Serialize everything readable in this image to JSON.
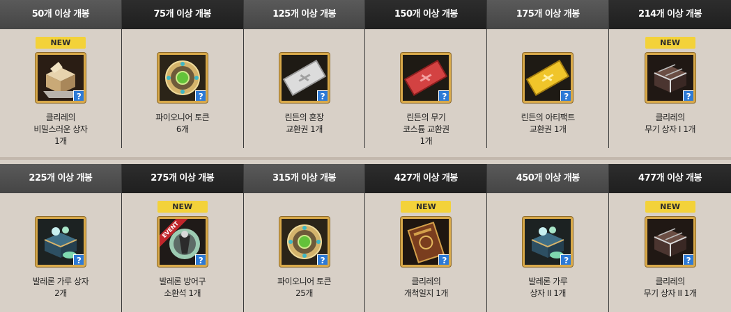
{
  "rows": [
    {
      "cells": [
        {
          "header": "50개 이상 개봉",
          "badge": "NEW",
          "icon": "box-icon",
          "lines": [
            "클리레의",
            "비밀스러운 상자",
            "1개"
          ]
        },
        {
          "header": "75개 이상 개봉",
          "badge": "",
          "icon": "pioneer-token-icon",
          "lines": [
            "파이오니어 토큰",
            "6개"
          ]
        },
        {
          "header": "125개 이상 개봉",
          "badge": "",
          "icon": "silver-ticket-icon",
          "lines": [
            "린든의 혼장",
            "교환권 1개"
          ]
        },
        {
          "header": "150개 이상 개봉",
          "badge": "",
          "icon": "red-ticket-icon",
          "lines": [
            "린든의 무기",
            "코스튬 교환권",
            "1개"
          ]
        },
        {
          "header": "175개 이상 개봉",
          "badge": "",
          "icon": "gold-ticket-icon",
          "lines": [
            "린든의 아티팩트",
            "교환권 1개"
          ]
        },
        {
          "header": "214개 이상 개봉",
          "badge": "NEW",
          "icon": "weapon-chest-icon",
          "lines": [
            "클리레의",
            "무기 상자 I 1개"
          ]
        }
      ]
    },
    {
      "cells": [
        {
          "header": "225개 이상 개봉",
          "badge": "",
          "icon": "powder-chest-icon",
          "lines": [
            "발레론 가루 상자",
            "2개"
          ]
        },
        {
          "header": "275개 이상 개봉",
          "badge": "NEW",
          "icon": "event-stone-icon",
          "event": "EVENT",
          "lines": [
            "발레론 방어구",
            "소환석 1개"
          ]
        },
        {
          "header": "315개 이상 개봉",
          "badge": "",
          "icon": "pioneer-token-icon",
          "lines": [
            "파이오니어 토큰",
            "25개"
          ]
        },
        {
          "header": "427개 이상 개봉",
          "badge": "NEW",
          "icon": "journal-icon",
          "lines": [
            "클리레의",
            "개척일지 1개"
          ]
        },
        {
          "header": "450개 이상 개봉",
          "badge": "",
          "icon": "powder-chest-icon",
          "lines": [
            "발레론 가루",
            "상자 II 1개"
          ]
        },
        {
          "header": "477개 이상 개봉",
          "badge": "NEW",
          "icon": "weapon-chest-icon",
          "lines": [
            "클리레의",
            "무기 상자 II 1개"
          ]
        }
      ]
    }
  ],
  "help_glyph": "?",
  "colors": {
    "badge": "#f3d23a",
    "header_light": "#4f4f4f",
    "header_dark": "#262626",
    "help": "#2d7ad6"
  }
}
